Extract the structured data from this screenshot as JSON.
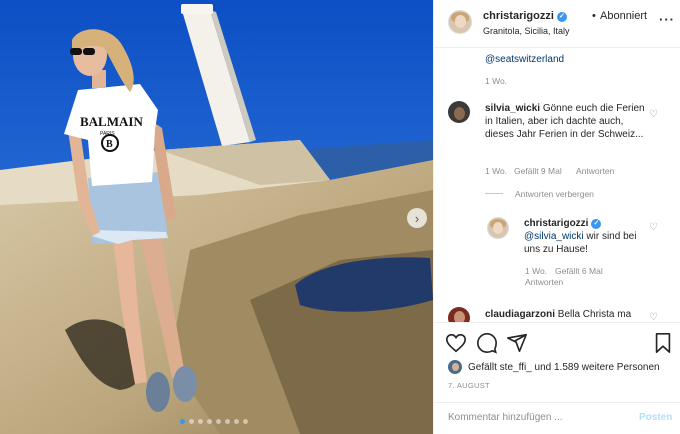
{
  "post": {
    "username": "christarigozzi",
    "separator": "•",
    "follow_status": "Abonniert",
    "location": "Granitola, Sicilia, Italy",
    "more_icon": "more-horizontal-icon"
  },
  "comments": {
    "partial": {
      "mention": "@seatswitzerland",
      "time": "1 Wo."
    },
    "comment1": {
      "username": "silvia_wicki",
      "text": "Gönne euch die Ferien in Italien, aber ich dachte auch, dieses Jahr Ferien in der Schweiz...",
      "time": "1 Wo.",
      "likes": "Gefällt 9 Mal",
      "reply": "Antworten",
      "hide_replies": "Antworten verbergen"
    },
    "reply1": {
      "username": "christarigozzi",
      "tag": "@silvia_wicki",
      "text": "wir sind bei uns zu Hause!",
      "time": "1 Wo.",
      "likes": "Gefällt 6 Mal",
      "reply": "Antworten"
    },
    "comment2": {
      "username": "claudiagarzoni",
      "text": "Bella Christa ma"
    }
  },
  "actions": {
    "likes_text": "Gefällt ste_ffi_ und 1.589 weitere Personen",
    "date": "7. AUGUST",
    "comment_placeholder": "Kommentar hinzufügen ...",
    "post_label": "Posten"
  },
  "carousel": {
    "count": 8,
    "active_index": 0
  },
  "colors": {
    "link": "#00376b",
    "verified": "#3897f0",
    "muted": "#8e8e8e",
    "post_disabled": "#b2dffc"
  }
}
